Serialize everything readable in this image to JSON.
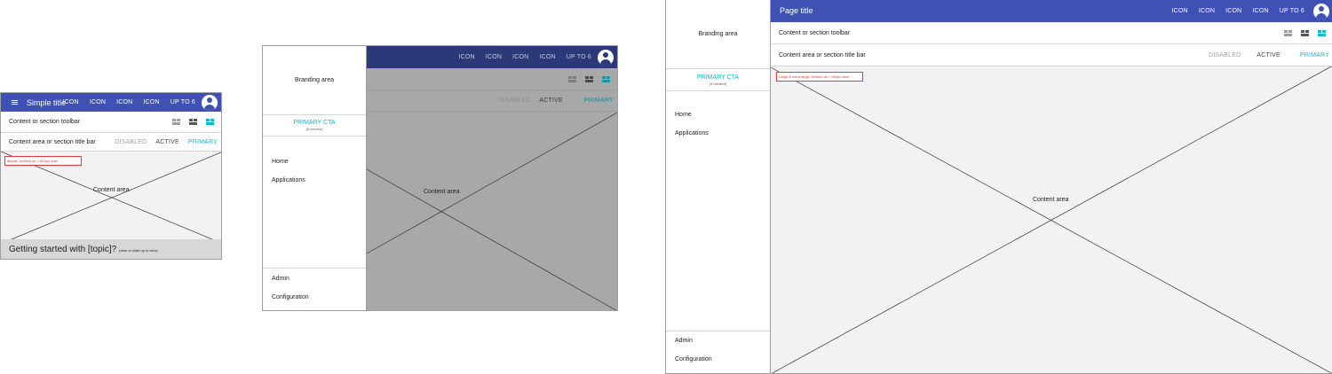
{
  "mobile": {
    "title": "Simple title",
    "actions": [
      "ICON",
      "ICON",
      "ICON",
      "ICON",
      "UP TO 6"
    ],
    "toolbar_label": "Content or section toolbar",
    "titlebar_label": "Content area or section title bar",
    "buttons": {
      "disabled": "DISABLED",
      "active": "ACTIVE",
      "primary": "PRIMARY"
    },
    "note": "Mobile: defined as < 600px wide",
    "content_label": "Content area",
    "bottom_sheet": {
      "title": "Getting started with [topic]?",
      "hint": "(click or slide up to view)"
    }
  },
  "tablet": {
    "actions": [
      "ICON",
      "ICON",
      "ICON",
      "ICON",
      "UP TO 6"
    ],
    "drawer": {
      "branding": "Branding area",
      "cta_label": "PRIMARY CTA",
      "cta_sub": "(if needed)",
      "nav": [
        "Home",
        "Applications"
      ],
      "admin": [
        "Admin",
        "Configuration"
      ]
    },
    "buttons": {
      "disabled": "DISABLED",
      "active": "ACTIVE",
      "primary": "PRIMARY"
    },
    "content_label": "Content area"
  },
  "desktop": {
    "title": "Page title",
    "actions": [
      "ICON",
      "ICON",
      "ICON",
      "ICON",
      "UP TO 6"
    ],
    "toolbar_label": "Content or section toolbar",
    "titlebar_label": "Content area or section title bar",
    "buttons": {
      "disabled": "DISABLED",
      "active": "ACTIVE",
      "primary": "PRIMARY"
    },
    "drawer": {
      "branding": "Branding area",
      "cta_label": "PRIMARY CTA",
      "cta_sub": "(if needed)",
      "nav": [
        "Home",
        "Applications"
      ],
      "admin": [
        "Admin",
        "Configuration"
      ]
    },
    "note": "Large & extra large: defined as > 960px wide",
    "content_label": "Content area"
  },
  "colors": {
    "primary": "#3f51b5",
    "accent": "#00bcd4",
    "note": "#e53935",
    "content_bg": "#f2f2f2",
    "scrim": "#a8a8a8"
  },
  "icons": [
    "menu-icon",
    "account-circle-icon",
    "group-icon"
  ]
}
